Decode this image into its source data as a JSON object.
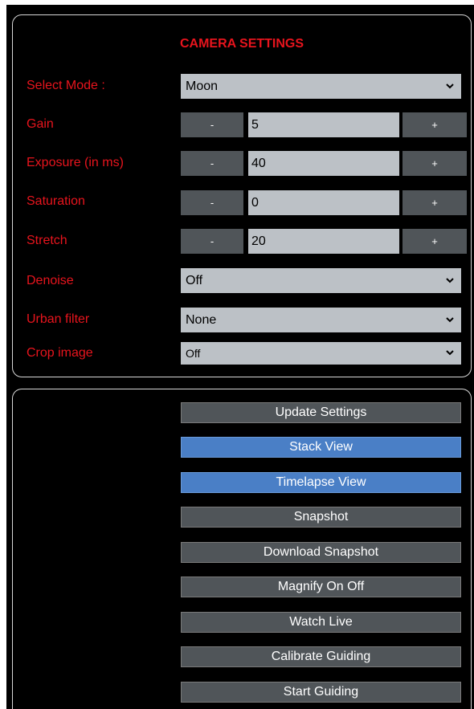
{
  "settings": {
    "title": "CAMERA SETTINGS",
    "mode": {
      "label": "Select Mode :",
      "value": "Moon"
    },
    "gain": {
      "label": "Gain",
      "value": "5",
      "minus": "-",
      "plus": "+"
    },
    "exposure": {
      "label": "Exposure (in ms)",
      "value": "40",
      "minus": "-",
      "plus": "+"
    },
    "saturation": {
      "label": "Saturation",
      "value": "0",
      "minus": "-",
      "plus": "+"
    },
    "stretch": {
      "label": "Stretch",
      "value": "20",
      "minus": "-",
      "plus": "+"
    },
    "denoise": {
      "label": "Denoise",
      "value": "Off"
    },
    "urban_filter": {
      "label": "Urban filter",
      "value": "None"
    },
    "crop_image": {
      "label": "Crop image",
      "value": "Off"
    }
  },
  "actions": {
    "update_settings": "Update Settings",
    "stack_view": "Stack View",
    "timelapse_view": "Timelapse View",
    "snapshot": "Snapshot",
    "download_snapshot": "Download Snapshot",
    "magnify": "Magnify On Off",
    "watch_live": "Watch Live",
    "calibrate_guiding": "Calibrate Guiding",
    "start_guiding": "Start Guiding"
  },
  "colors": {
    "label_red": "#e8141d",
    "button_gray": "#505559",
    "button_blue": "#4a7fc6",
    "field_gray": "#bcc1c6"
  }
}
